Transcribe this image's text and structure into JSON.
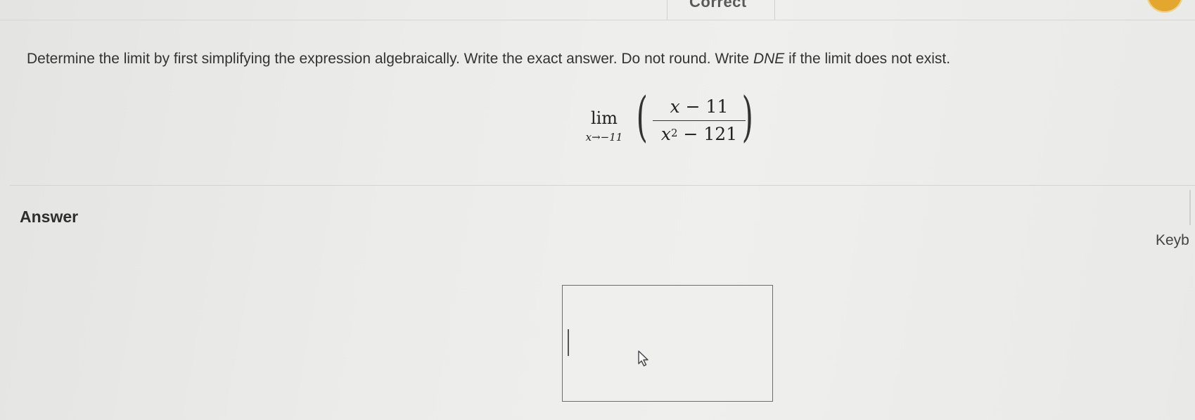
{
  "top_bar": {
    "tab_label": "Correct"
  },
  "question": {
    "text_before": "Determine the limit by first simplifying the expression algebraically. Write the exact answer. Do not round. Write ",
    "emphasis": "DNE",
    "text_after": " if the limit does not exist."
  },
  "expression": {
    "lim_word": "lim",
    "subscript": "x→−11",
    "numerator_var": "x",
    "numerator_rest": " − 11",
    "denominator_var": "x",
    "denominator_exp": "2",
    "denominator_rest": " − 121"
  },
  "answer": {
    "label": "Answer",
    "value": ""
  },
  "keyboard_label": "Keyb",
  "colors": {
    "badge": "#e3a72f",
    "background": "#ececea"
  }
}
